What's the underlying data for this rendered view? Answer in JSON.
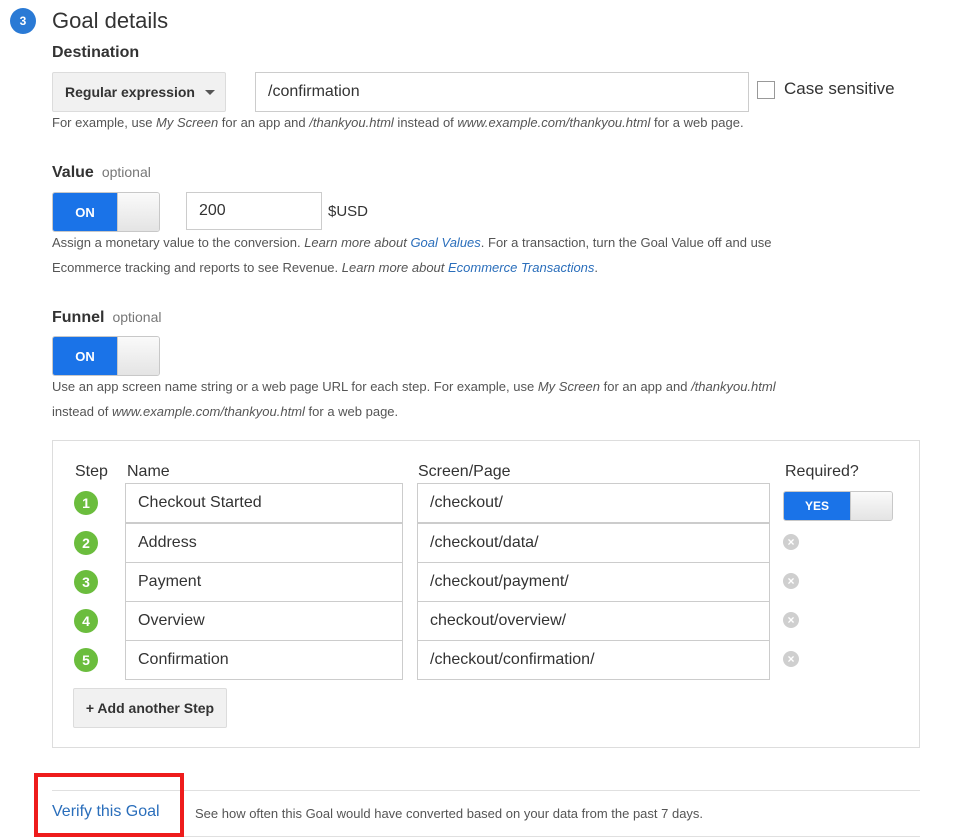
{
  "section": {
    "number": "3",
    "title": "Goal details"
  },
  "destination": {
    "label": "Destination",
    "match_type": "Regular expression",
    "value": "/confirmation",
    "case_sensitive_label": "Case sensitive",
    "help": {
      "p1": "For example, use ",
      "i1": "My Screen",
      "p2": " for an app and ",
      "i2": "/thankyou.html",
      "p3": " instead of ",
      "i3": "www.example.com/thankyou.html",
      "p4": " for a web page."
    }
  },
  "value": {
    "label": "Value",
    "optional": "optional",
    "toggle": "ON",
    "amount": "200",
    "currency": "$USD",
    "help": {
      "p1": "Assign a monetary value to the conversion. ",
      "i1": "Learn more about ",
      "link1": "Goal Values",
      "p2": ". For a transaction, turn the Goal Value off and use",
      "p3": "Ecommerce tracking and reports to see Revenue. ",
      "i2": "Learn more about ",
      "link2": "Ecommerce Transactions",
      "p4": "."
    }
  },
  "funnel": {
    "label": "Funnel",
    "optional": "optional",
    "toggle": "ON",
    "help": {
      "p1": "Use an app screen name string or a web page URL for each step. For example, use ",
      "i1": "My Screen",
      "p2": " for an app and ",
      "i2": "/thankyou.html",
      "p3": "instead of ",
      "i3": "www.example.com/thankyou.html",
      "p4": " for a web page."
    },
    "columns": {
      "step": "Step",
      "name": "Name",
      "page": "Screen/Page",
      "required": "Required?"
    },
    "required_toggle": "YES",
    "steps": [
      {
        "num": "1",
        "name": "Checkout Started",
        "page": "/checkout/"
      },
      {
        "num": "2",
        "name": "Address",
        "page": "/checkout/data/"
      },
      {
        "num": "3",
        "name": "Payment",
        "page": "/checkout/payment/"
      },
      {
        "num": "4",
        "name": "Overview",
        "page": "checkout/overview/"
      },
      {
        "num": "5",
        "name": "Confirmation",
        "page": "/checkout/confirmation/"
      }
    ],
    "add_step": "+ Add another Step"
  },
  "verify": {
    "link": "Verify this Goal",
    "text": "See how often this Goal would have converted based on your data from the past 7 days."
  },
  "colors": {
    "accent": "#1a73e8",
    "step_green": "#6bbd3d",
    "highlight": "#ee1c1c",
    "link": "#2a6ebb"
  }
}
